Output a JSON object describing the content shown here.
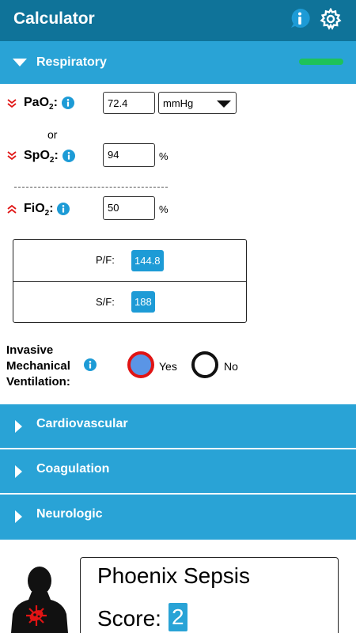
{
  "app": {
    "title": "Calculator"
  },
  "topbar": {
    "info_icon": "info-icon",
    "settings_icon": "gear-icon"
  },
  "respiratory": {
    "label": "Respiratory",
    "progress_fraction": 1.0,
    "pao2": {
      "label": "PaO",
      "sub": "2",
      "suffix": ":",
      "value": "72.4",
      "unit_selected": "mmHg"
    },
    "or_text": "or",
    "spo2": {
      "label": "SpO",
      "sub": "2",
      "suffix": ":",
      "value": "94",
      "unit": "%"
    },
    "fio2": {
      "label": "FiO",
      "sub": "2",
      "suffix": ":",
      "value": "50",
      "unit": "%"
    },
    "pf": {
      "label": "P/F:",
      "value": "144.8"
    },
    "sf": {
      "label": "S/F:",
      "value": "188"
    },
    "imv": {
      "line1": "Invasive",
      "line2": "Mechanical",
      "line3": "Ventilation:",
      "yes": "Yes",
      "no": "No",
      "selected": "Yes"
    }
  },
  "sections": [
    {
      "label": "Cardiovascular"
    },
    {
      "label": "Coagulation"
    },
    {
      "label": "Neurologic"
    }
  ],
  "score": {
    "title": "Phoenix Sepsis",
    "label": "Score:",
    "value": "2"
  },
  "colors": {
    "topbar": "#0f7399",
    "section": "#29a3d6",
    "accent_red": "#e01414",
    "progress_green": "#1ec25a"
  }
}
